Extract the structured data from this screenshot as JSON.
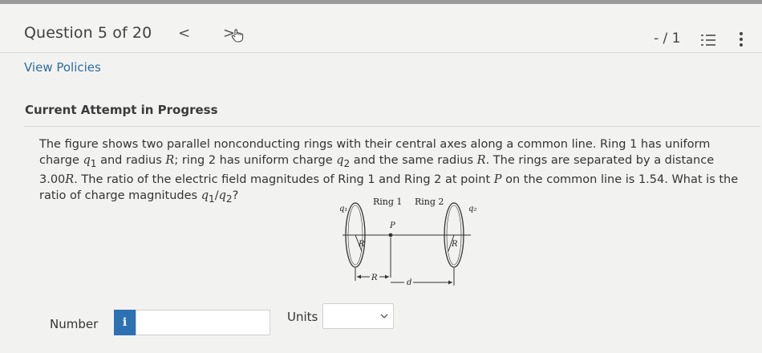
{
  "header": {
    "question_label": "Question 5 of 20",
    "prev_symbol": "<",
    "next_symbol": ">",
    "score": "- / 1"
  },
  "links": {
    "view_policies": "View Policies"
  },
  "attempt": {
    "title": "Current Attempt in Progress"
  },
  "question": {
    "text_parts": [
      "The figure shows two parallel nonconducting rings with their central axes along a common line. Ring 1 has uniform charge ",
      "q",
      "1",
      " and radius ",
      "R",
      "; ring 2 has uniform charge ",
      "q",
      "2",
      " and the same radius ",
      "R",
      ". The rings are separated by a distance 3.00",
      "R",
      ". The ratio of the electric field magnitudes of Ring 1 and Ring 2 at point ",
      "P",
      " on the common line is 1.54. What is the ratio of charge magnitudes ",
      "q",
      "1",
      "/",
      "q",
      "2",
      "?"
    ]
  },
  "figure": {
    "ring1_label": "Ring 1",
    "ring2_label": "Ring 2",
    "q1_label": "q₁",
    "q2_label": "q₂",
    "p_label": "P",
    "r_label_left": "R",
    "r_label_right": "R",
    "r_dim_label": "R",
    "d_label": "d"
  },
  "answer": {
    "number_label": "Number",
    "info_symbol": "i",
    "number_value": "",
    "units_label": "Units",
    "units_value": ""
  },
  "icons": {
    "list": "list-icon",
    "more": "more-vertical-icon",
    "hand": "hand-pointer-icon",
    "chevron": "chevron-down-icon"
  },
  "colors": {
    "accent_blue": "#2d71b3",
    "link_blue": "#2f6c9e",
    "background": "#f2f2f0"
  }
}
